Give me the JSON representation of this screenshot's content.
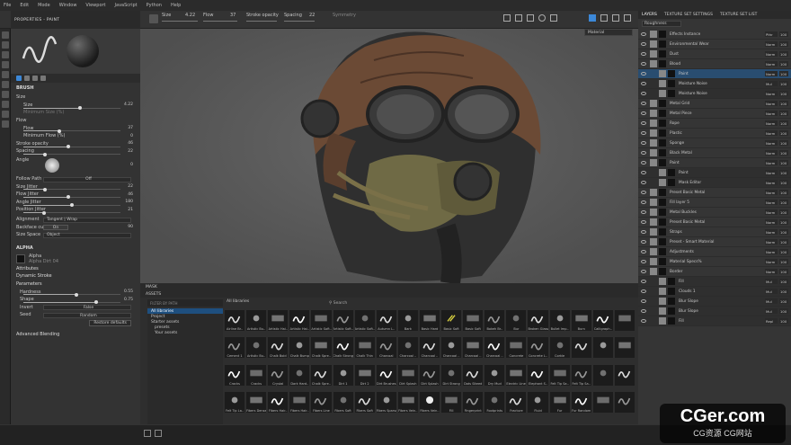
{
  "menu": [
    "File",
    "Edit",
    "Mode",
    "Window",
    "Viewport",
    "JavaScript",
    "Python",
    "Help"
  ],
  "toolbar": {
    "size_label": "Size",
    "size_value": "4.22",
    "flow_label": "Flow",
    "flow_value": "37",
    "stroke_opacity_label": "Stroke opacity",
    "spacing_label": "Spacing",
    "spacing_value": "22",
    "symmetry_label": "Symmetry"
  },
  "properties": {
    "title": "PROPERTIES - PAINT",
    "brush_section": "BRUSH",
    "size_group": "Size",
    "size_label": "Size",
    "size_value": "4.22",
    "min_size_label": "Minimum Size (%)",
    "flow_group": "Flow",
    "flow_label": "Flow",
    "flow_value": "37",
    "min_flow_label": "Minimum Flow (%)",
    "min_flow_value": "0",
    "stroke_opacity_label": "Stroke opacity",
    "stroke_opacity_value": "46",
    "spacing_label": "Spacing",
    "spacing_value": "22",
    "angle_label": "Angle",
    "angle_value": "0",
    "follow_path_label": "Follow Path",
    "follow_path_value": "Off",
    "size_jitter_label": "Size Jitter",
    "size_jitter_value": "22",
    "flow_jitter_label": "Flow Jitter",
    "flow_jitter_value": "46",
    "angle_jitter_label": "Angle Jitter",
    "angle_jitter_value": "180",
    "position_jitter_label": "Position Jitter",
    "position_jitter_value": "21",
    "alignment_label": "Alignment",
    "alignment_value": "Tangent | Wrap",
    "backface_label": "Backface culling",
    "backface_value": "On",
    "backface_num": "90",
    "size_space_label": "Size Space",
    "size_space_value": "Object",
    "alpha_section": "ALPHA",
    "alpha_name": "Alpha",
    "alpha_sub": "Alpha Dirt 04",
    "attributes_label": "Attributes",
    "dynamic_stroke_label": "Dynamic Stroke",
    "parameters_label": "Parameters",
    "hardness_label": "Hardness",
    "hardness_value": "0.55",
    "shape_label": "Shape",
    "shape_value": "0.75",
    "invert_label": "Invert",
    "invert_value": "False",
    "seed_label": "Seed",
    "seed_value": "Random",
    "restore_label": "Restore defaults",
    "advanced_label": "Advanced Blending"
  },
  "viewport": {
    "mode": "Material"
  },
  "assets": {
    "tab": "MASK",
    "title": "ASSETS",
    "filter": "FILTER BY PATH",
    "library": "All libraries",
    "search": "Search",
    "tree": [
      "All libraries",
      "Project",
      "Starter assets",
      "presets",
      "Your assets"
    ],
    "items": [
      "Airline Br..",
      "Artistic Bu..",
      "Artistic Hai..",
      "Artistic Hai..",
      "Artistic Soft..",
      "Artistic Soft..",
      "Artistic Soft..",
      "Autumn L..",
      "Bark",
      "Basic Hard",
      "Basic Soft",
      "Basic Soft",
      "Bokeh Br..",
      "Bur",
      "Broken Glass",
      "Bullet Imp..",
      "Burn",
      "Calligraph..",
      "",
      "Cement 1",
      "Artistic Bu..",
      "Chalk Bold",
      "Chalk Bump",
      "Chalk Spre..",
      "Chalk Strong",
      "Chalk Thin",
      "Charcoal",
      "Charcoal ..",
      "Charcoal ..",
      "Charcoal ..",
      "Charcoal ..",
      "Charcoal ..",
      "Concrete",
      "Concrete L..",
      "Corkle",
      "",
      "",
      "",
      "Cracks",
      "Cracks",
      "Crystal",
      "Dark Hard..",
      "Chalk Spre..",
      "Dirt 1",
      "Dirt 2",
      "Dirt Brushes",
      "Dirt Splash",
      "Dirt Splash",
      "Dirt Strong",
      "Dots Siteed",
      "Dry Mud",
      "Electric Lines",
      "Elephant S..",
      "Felt Tip Sa..",
      "Felt Tip Sa..",
      "",
      "",
      "Felt Tip La..",
      "Fibers Dense",
      "Fibers Hair..",
      "Fibers Hair..",
      "Fibers Line",
      "Fibers Soft",
      "Fibers Soft",
      "Fibers Sparse",
      "Fibers Vein..",
      "Fibers Vein..",
      "Fill",
      "Fingerprint",
      "Footprints",
      "Fracture",
      "Fluid",
      "Fur",
      "Fur Random",
      "",
      ""
    ]
  },
  "layers": {
    "tabs": [
      "LAYERS",
      "TEXTURE SET SETTINGS",
      "TEXTURE SET LIST"
    ],
    "channel": "Roughness",
    "rows": [
      {
        "name": "Effects Instance",
        "blend": "Pthr",
        "op": "100",
        "sub": false
      },
      {
        "name": "Environmental Wear",
        "blend": "Norm",
        "op": "100",
        "sub": false
      },
      {
        "name": "Dust",
        "blend": "Norm",
        "op": "100",
        "sub": false
      },
      {
        "name": "Blood",
        "blend": "Norm",
        "op": "100",
        "sub": false
      },
      {
        "name": "Paint",
        "blend": "Norm",
        "op": "100",
        "sub": true,
        "hl": true
      },
      {
        "name": "Moisture Noise",
        "blend": "Mul",
        "op": "100",
        "sub": true
      },
      {
        "name": "Moisture Noise",
        "blend": "Norm",
        "op": "100",
        "sub": true
      },
      {
        "name": "Metal Grid",
        "blend": "Norm",
        "op": "100",
        "sub": false
      },
      {
        "name": "Metal Piece",
        "blend": "Norm",
        "op": "100",
        "sub": false
      },
      {
        "name": "Rope",
        "blend": "Norm",
        "op": "100",
        "sub": false
      },
      {
        "name": "Plastic",
        "blend": "Norm",
        "op": "100",
        "sub": false
      },
      {
        "name": "Sponge",
        "blend": "Norm",
        "op": "100",
        "sub": false
      },
      {
        "name": "Black Metal",
        "blend": "Norm",
        "op": "100",
        "sub": false
      },
      {
        "name": "Paint",
        "blend": "Norm",
        "op": "100",
        "sub": false
      },
      {
        "name": "Paint",
        "blend": "Norm",
        "op": "100",
        "sub": true
      },
      {
        "name": "Mask Editor",
        "blend": "Norm",
        "op": "100",
        "sub": true
      },
      {
        "name": "Preset Basic Metal",
        "blend": "Norm",
        "op": "100",
        "sub": false
      },
      {
        "name": "Fill layer 5",
        "blend": "Norm",
        "op": "100",
        "sub": false
      },
      {
        "name": "Metal Buckles",
        "blend": "Norm",
        "op": "100",
        "sub": false
      },
      {
        "name": "Preset Basic Metal",
        "blend": "Norm",
        "op": "100",
        "sub": false
      },
      {
        "name": "Straps",
        "blend": "Norm",
        "op": "100",
        "sub": false
      },
      {
        "name": "Preset - Smart Material",
        "blend": "Norm",
        "op": "100",
        "sub": false
      },
      {
        "name": "Adjustments",
        "blend": "Norm",
        "op": "100",
        "sub": false
      },
      {
        "name": "Material Specs%",
        "blend": "Norm",
        "op": "100",
        "sub": false
      },
      {
        "name": "Border",
        "blend": "Norm",
        "op": "100",
        "sub": false
      },
      {
        "name": "Fill",
        "blend": "Mul",
        "op": "100",
        "sub": true
      },
      {
        "name": "Clouds 1",
        "blend": "Mul",
        "op": "100",
        "sub": true
      },
      {
        "name": "Blur Slope",
        "blend": "Mul",
        "op": "100",
        "sub": true
      },
      {
        "name": "Blur Slope",
        "blend": "Mul",
        "op": "100",
        "sub": true
      },
      {
        "name": "Fill",
        "blend": "Repl",
        "op": "100",
        "sub": true
      }
    ]
  },
  "watermark": {
    "line1": "CGer.com",
    "line2": "CG资源 CG网站"
  }
}
